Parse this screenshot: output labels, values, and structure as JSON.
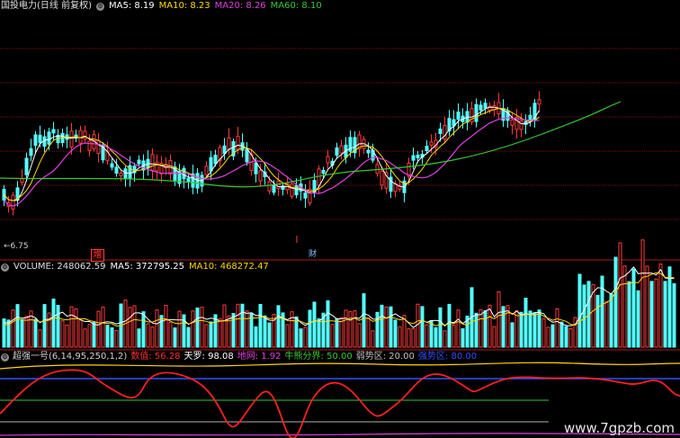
{
  "price_panel": {
    "stock_title": "国投电力(日线 前复权)",
    "ma5": "MA5: 8.19",
    "ma10": "MA10: 8.23",
    "ma20": "MA20: 8.26",
    "ma60": "MA60: 8.10",
    "low_marker": "6.75",
    "tag_add": "增",
    "tag_fin": "财",
    "colors": {
      "up": "#ff3a3a",
      "down": "#54ffff",
      "ma5": "#ffffff",
      "ma10": "#ffd700",
      "ma20": "#e040e0",
      "ma60": "#36c836",
      "grid": "#8a1010"
    }
  },
  "volume_panel": {
    "title": "VOLUME: 248062.59",
    "ma5": "MA5: 372795.25",
    "ma10": "MA10: 468272.47"
  },
  "indicator_panel": {
    "title": "超强一号(6,14,95,250,1,2)",
    "shuzhi_label": "数值:",
    "shuzhi_value": "56.28",
    "tianluo": "天罗: 98.08",
    "diwang": "地网: 1.92",
    "niuxiong": "牛熊分界: 50.00",
    "ruoshi": "弱势区: 20.00",
    "qiangshi": "强势区: 80.00"
  },
  "watermark": "www.7gpzb.com"
}
